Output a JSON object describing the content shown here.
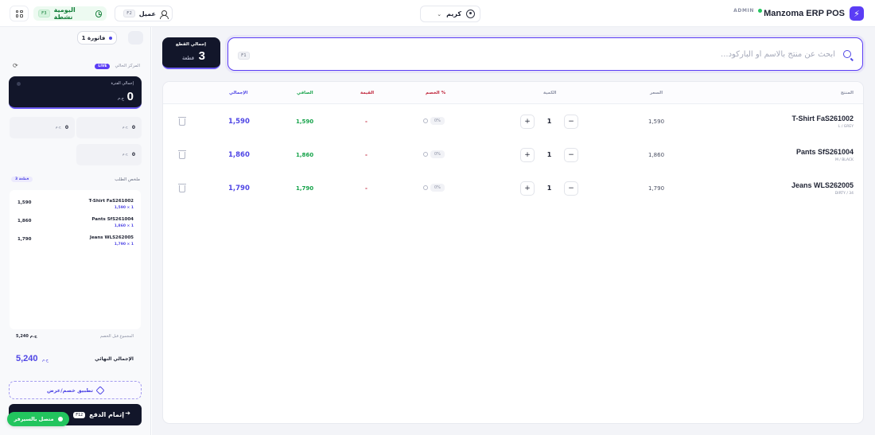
{
  "header": {
    "brand": "Manzoma ERP POS",
    "role": "ADMIN",
    "user_name": "كريم",
    "customer_label": "عميل",
    "customer_shortcut": "F2",
    "daily_label": "اليومية نشطة",
    "daily_shortcut": "F3"
  },
  "sidebar": {
    "invoice_tab": "فاتورة 1",
    "current_label": "المركز الحالي",
    "live_badge": "LIVE",
    "current_card": {
      "label": "إجمالي الفترة",
      "value": "0",
      "unit": "ج.م"
    },
    "mini_cards": [
      {
        "value": "0",
        "unit": "ج.م"
      },
      {
        "value": "0",
        "unit": "ج.م"
      },
      {
        "value": "0",
        "unit": "ج.م"
      }
    ],
    "summary_title": "ملخص الطلب",
    "summary_count": "3 قطعة",
    "summary_items": [
      {
        "name": "T-Shirt FaS261002",
        "sub": "1,590 × 1",
        "total": "1,590"
      },
      {
        "name": "Pants SfS261004",
        "sub": "1,860 × 1",
        "total": "1,860"
      },
      {
        "name": "Jeans WLS262005",
        "sub": "1,790 × 1",
        "total": "1,790"
      }
    ],
    "subtotal_label": "المجموع قبل الخصم",
    "subtotal_value": "5,240 ج.م",
    "grand_label": "الإجمالي النهائي",
    "grand_value": "5,240",
    "grand_unit": "ج.م",
    "discount_button": "تطبيق خصم/عرض",
    "pay_button": "إتمام الدفع",
    "pay_shortcut": "F12",
    "server_status": "متصل بالسيرفر"
  },
  "main": {
    "search_placeholder": "ابحث عن منتج بالاسم أو الباركود...",
    "search_shortcut": "F1",
    "pieces_label": "إجمالي القطع",
    "pieces_value": "3",
    "pieces_unit": "قطعة",
    "columns": {
      "product": "المنتج",
      "price": "السعر",
      "qty": "الكمية",
      "discount": "الخصم %",
      "value": "القيمة",
      "net": "الصافي",
      "total": "الإجمالي"
    },
    "rows": [
      {
        "name": "T-Shirt FaS261002",
        "variant": "L / GREY",
        "price": "1,590",
        "qty": "1",
        "discount": "0%",
        "value": "-",
        "net": "1,590",
        "total": "1,590"
      },
      {
        "name": "Pants SfS261004",
        "variant": "M / BLACK",
        "price": "1,860",
        "qty": "1",
        "discount": "0%",
        "value": "-",
        "net": "1,860",
        "total": "1,860"
      },
      {
        "name": "Jeans WLS262005",
        "variant": "DIRTY / 34",
        "price": "1,790",
        "qty": "1",
        "discount": "0%",
        "value": "-",
        "net": "1,790",
        "total": "1,790"
      }
    ]
  },
  "icons": {
    "brand": "bolt-icon",
    "user": "user-circle-icon",
    "customer": "person-icon",
    "daily": "clock-icon",
    "apps": "grid-icon",
    "search": "search-icon",
    "refresh": "refresh-icon",
    "discount": "tag-icon",
    "delete": "trash-icon"
  },
  "colors": {
    "accent": "#5b3df5",
    "dark": "#12162a",
    "positive": "#16a34a",
    "negative": "#c0263c",
    "online": "#22c55e"
  }
}
